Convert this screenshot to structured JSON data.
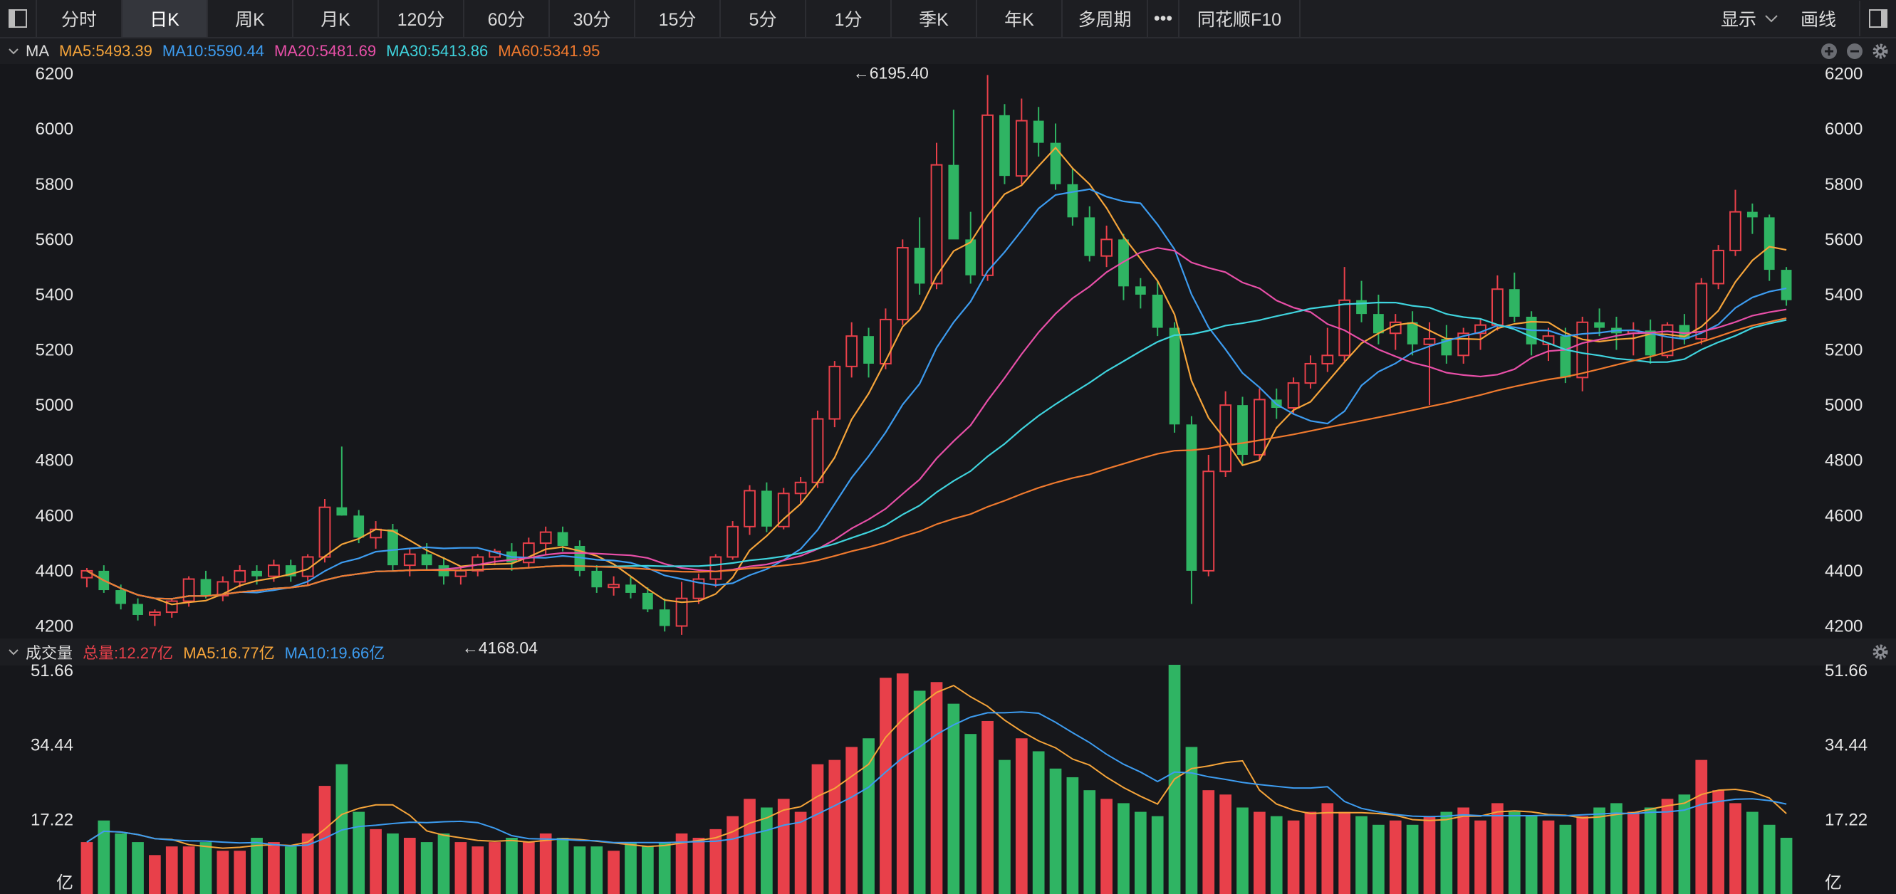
{
  "toolbar": {
    "tabs": [
      "分时",
      "日K",
      "周K",
      "月K",
      "120分",
      "60分",
      "30分",
      "15分",
      "5分",
      "1分",
      "季K",
      "年K",
      "多周期"
    ],
    "active": 1,
    "more": "•••",
    "f10": "同花顺F10",
    "display": "显示",
    "draw": "画线"
  },
  "main_panel": {
    "label": "MA",
    "indicators": [
      {
        "text": "MA5:5493.39",
        "color": "#f5a43a"
      },
      {
        "text": "MA10:5590.44",
        "color": "#3d9cf0"
      },
      {
        "text": "MA20:5481.69",
        "color": "#e84fa8"
      },
      {
        "text": "MA30:5413.86",
        "color": "#3fd4de"
      },
      {
        "text": "MA60:5341.95",
        "color": "#f07a2e"
      }
    ],
    "high_label": "←6195.40",
    "low_label": "←4168.04"
  },
  "volume_panel": {
    "label": "成交量",
    "indicators": [
      {
        "text": "总量:12.27亿",
        "color": "#e8404a"
      },
      {
        "text": "MA5:16.77亿",
        "color": "#f5a43a"
      },
      {
        "text": "MA10:19.66亿",
        "color": "#3d9cf0"
      }
    ]
  },
  "colors": {
    "up": "#e8404a",
    "down": "#2fb463",
    "ma5": "#f5a43a",
    "ma10": "#3d9cf0",
    "ma20": "#e84fa8",
    "ma30": "#3fd4de",
    "ma60": "#f07a2e"
  },
  "chart_data": [
    {
      "type": "candlestick",
      "y_ticks": [
        "6200",
        "6000",
        "5800",
        "5600",
        "5400",
        "5200",
        "5000",
        "4800",
        "4600",
        "4400",
        "4200"
      ],
      "ylim": [
        4160,
        6230
      ],
      "high": {
        "value": 6195.4,
        "index": 45
      },
      "low": {
        "value": 4168.04,
        "index": 22
      },
      "ohlc": [
        [
          4375,
          4410,
          4340,
          4400
        ],
        [
          4400,
          4420,
          4320,
          4330
        ],
        [
          4330,
          4350,
          4260,
          4280
        ],
        [
          4280,
          4300,
          4220,
          4240
        ],
        [
          4240,
          4260,
          4200,
          4250
        ],
        [
          4250,
          4300,
          4230,
          4290
        ],
        [
          4290,
          4380,
          4270,
          4370
        ],
        [
          4370,
          4400,
          4300,
          4310
        ],
        [
          4310,
          4380,
          4290,
          4360
        ],
        [
          4360,
          4420,
          4340,
          4400
        ],
        [
          4400,
          4420,
          4350,
          4380
        ],
        [
          4380,
          4440,
          4360,
          4420
        ],
        [
          4420,
          4440,
          4360,
          4380
        ],
        [
          4380,
          4460,
          4350,
          4450
        ],
        [
          4450,
          4660,
          4430,
          4630
        ],
        [
          4630,
          4850,
          4600,
          4600
        ],
        [
          4600,
          4620,
          4500,
          4520
        ],
        [
          4520,
          4580,
          4480,
          4550
        ],
        [
          4550,
          4570,
          4400,
          4420
        ],
        [
          4420,
          4480,
          4380,
          4460
        ],
        [
          4460,
          4500,
          4400,
          4420
        ],
        [
          4420,
          4450,
          4350,
          4380
        ],
        [
          4380,
          4410,
          4350,
          4400
        ],
        [
          4400,
          4460,
          4380,
          4450
        ],
        [
          4450,
          4480,
          4420,
          4470
        ],
        [
          4470,
          4500,
          4400,
          4430
        ],
        [
          4430,
          4520,
          4410,
          4500
        ],
        [
          4500,
          4560,
          4460,
          4540
        ],
        [
          4540,
          4560,
          4470,
          4490
        ],
        [
          4490,
          4510,
          4380,
          4400
        ],
        [
          4400,
          4420,
          4320,
          4340
        ],
        [
          4340,
          4380,
          4310,
          4350
        ],
        [
          4350,
          4380,
          4300,
          4320
        ],
        [
          4320,
          4340,
          4250,
          4260
        ],
        [
          4260,
          4300,
          4180,
          4200
        ],
        [
          4200,
          4360,
          4168,
          4300
        ],
        [
          4300,
          4390,
          4280,
          4370
        ],
        [
          4370,
          4460,
          4340,
          4450
        ],
        [
          4450,
          4580,
          4440,
          4560
        ],
        [
          4560,
          4710,
          4530,
          4690
        ],
        [
          4690,
          4720,
          4540,
          4560
        ],
        [
          4560,
          4700,
          4550,
          4680
        ],
        [
          4680,
          4740,
          4640,
          4720
        ],
        [
          4720,
          4980,
          4700,
          4950
        ],
        [
          4950,
          5160,
          4920,
          5140
        ],
        [
          5140,
          5300,
          5100,
          5250
        ],
        [
          5250,
          5280,
          5100,
          5150
        ],
        [
          5150,
          5350,
          5130,
          5310
        ],
        [
          5310,
          5600,
          5290,
          5570
        ],
        [
          5570,
          5680,
          5400,
          5440
        ],
        [
          5440,
          5950,
          5420,
          5870
        ],
        [
          5870,
          6070,
          5700,
          5600
        ],
        [
          5600,
          5700,
          5440,
          5470
        ],
        [
          5470,
          6195.4,
          5450,
          6050
        ],
        [
          6050,
          6090,
          5800,
          5830
        ],
        [
          5830,
          6110,
          5800,
          6030
        ],
        [
          6030,
          6080,
          5900,
          5950
        ],
        [
          5950,
          6020,
          5780,
          5800
        ],
        [
          5800,
          5860,
          5650,
          5680
        ],
        [
          5680,
          5720,
          5520,
          5540
        ],
        [
          5540,
          5650,
          5500,
          5600
        ],
        [
          5600,
          5620,
          5380,
          5430
        ],
        [
          5430,
          5460,
          5350,
          5400
        ],
        [
          5400,
          5450,
          5250,
          5280
        ],
        [
          5280,
          5300,
          4900,
          4930
        ],
        [
          4930,
          4960,
          4280,
          4400
        ],
        [
          4400,
          4820,
          4380,
          4760
        ],
        [
          4760,
          5050,
          4740,
          5000
        ],
        [
          5000,
          5030,
          4780,
          4820
        ],
        [
          4820,
          5060,
          4800,
          5020
        ],
        [
          5020,
          5060,
          4950,
          4990
        ],
        [
          4990,
          5100,
          4970,
          5080
        ],
        [
          5080,
          5180,
          5060,
          5150
        ],
        [
          5150,
          5280,
          5120,
          5180
        ],
        [
          5180,
          5500,
          5160,
          5380
        ],
        [
          5380,
          5450,
          5300,
          5330
        ],
        [
          5330,
          5400,
          5220,
          5260
        ],
        [
          5260,
          5330,
          5200,
          5300
        ],
        [
          5300,
          5340,
          5180,
          5220
        ],
        [
          5220,
          5300,
          5000,
          5240
        ],
        [
          5240,
          5290,
          5150,
          5180
        ],
        [
          5180,
          5280,
          5150,
          5260
        ],
        [
          5260,
          5310,
          5200,
          5290
        ],
        [
          5290,
          5470,
          5270,
          5420
        ],
        [
          5420,
          5480,
          5300,
          5320
        ],
        [
          5320,
          5340,
          5180,
          5220
        ],
        [
          5220,
          5280,
          5160,
          5250
        ],
        [
          5250,
          5280,
          5080,
          5100
        ],
        [
          5100,
          5320,
          5050,
          5300
        ],
        [
          5300,
          5350,
          5250,
          5280
        ],
        [
          5280,
          5320,
          5200,
          5260
        ],
        [
          5260,
          5300,
          5180,
          5270
        ],
        [
          5270,
          5310,
          5150,
          5180
        ],
        [
          5180,
          5300,
          5170,
          5290
        ],
        [
          5290,
          5330,
          5220,
          5240
        ],
        [
          5240,
          5460,
          5220,
          5440
        ],
        [
          5440,
          5580,
          5420,
          5560
        ],
        [
          5560,
          5780,
          5540,
          5700
        ],
        [
          5700,
          5730,
          5620,
          5680
        ],
        [
          5680,
          5690,
          5450,
          5490
        ],
        [
          5490,
          5500,
          5360,
          5380
        ]
      ],
      "volume_ylim": [
        0,
        52.5
      ],
      "volume_ticks": [
        "51.66",
        "34.44",
        "17.22",
        "亿"
      ],
      "volume": [
        12,
        17,
        14,
        12,
        9,
        11,
        11,
        12,
        10,
        10,
        13,
        12,
        11,
        14,
        25,
        30,
        19,
        15,
        14,
        13,
        12,
        14,
        12,
        11,
        12,
        13,
        12,
        14,
        13,
        11,
        11,
        10,
        12,
        11,
        12,
        14,
        13,
        15,
        18,
        22,
        20,
        22,
        19,
        30,
        31,
        34,
        36,
        50,
        51,
        47,
        49,
        44,
        37,
        40,
        31,
        36,
        33,
        29,
        27,
        24,
        22,
        21,
        19,
        18,
        53,
        34,
        24,
        23,
        20,
        19,
        18,
        17,
        19,
        21,
        19,
        18,
        16,
        17,
        16,
        18,
        19,
        20,
        17,
        21,
        19,
        18,
        17,
        16,
        18,
        20,
        21,
        19,
        20,
        22,
        23,
        31,
        24,
        21,
        19,
        16,
        13
      ]
    }
  ]
}
